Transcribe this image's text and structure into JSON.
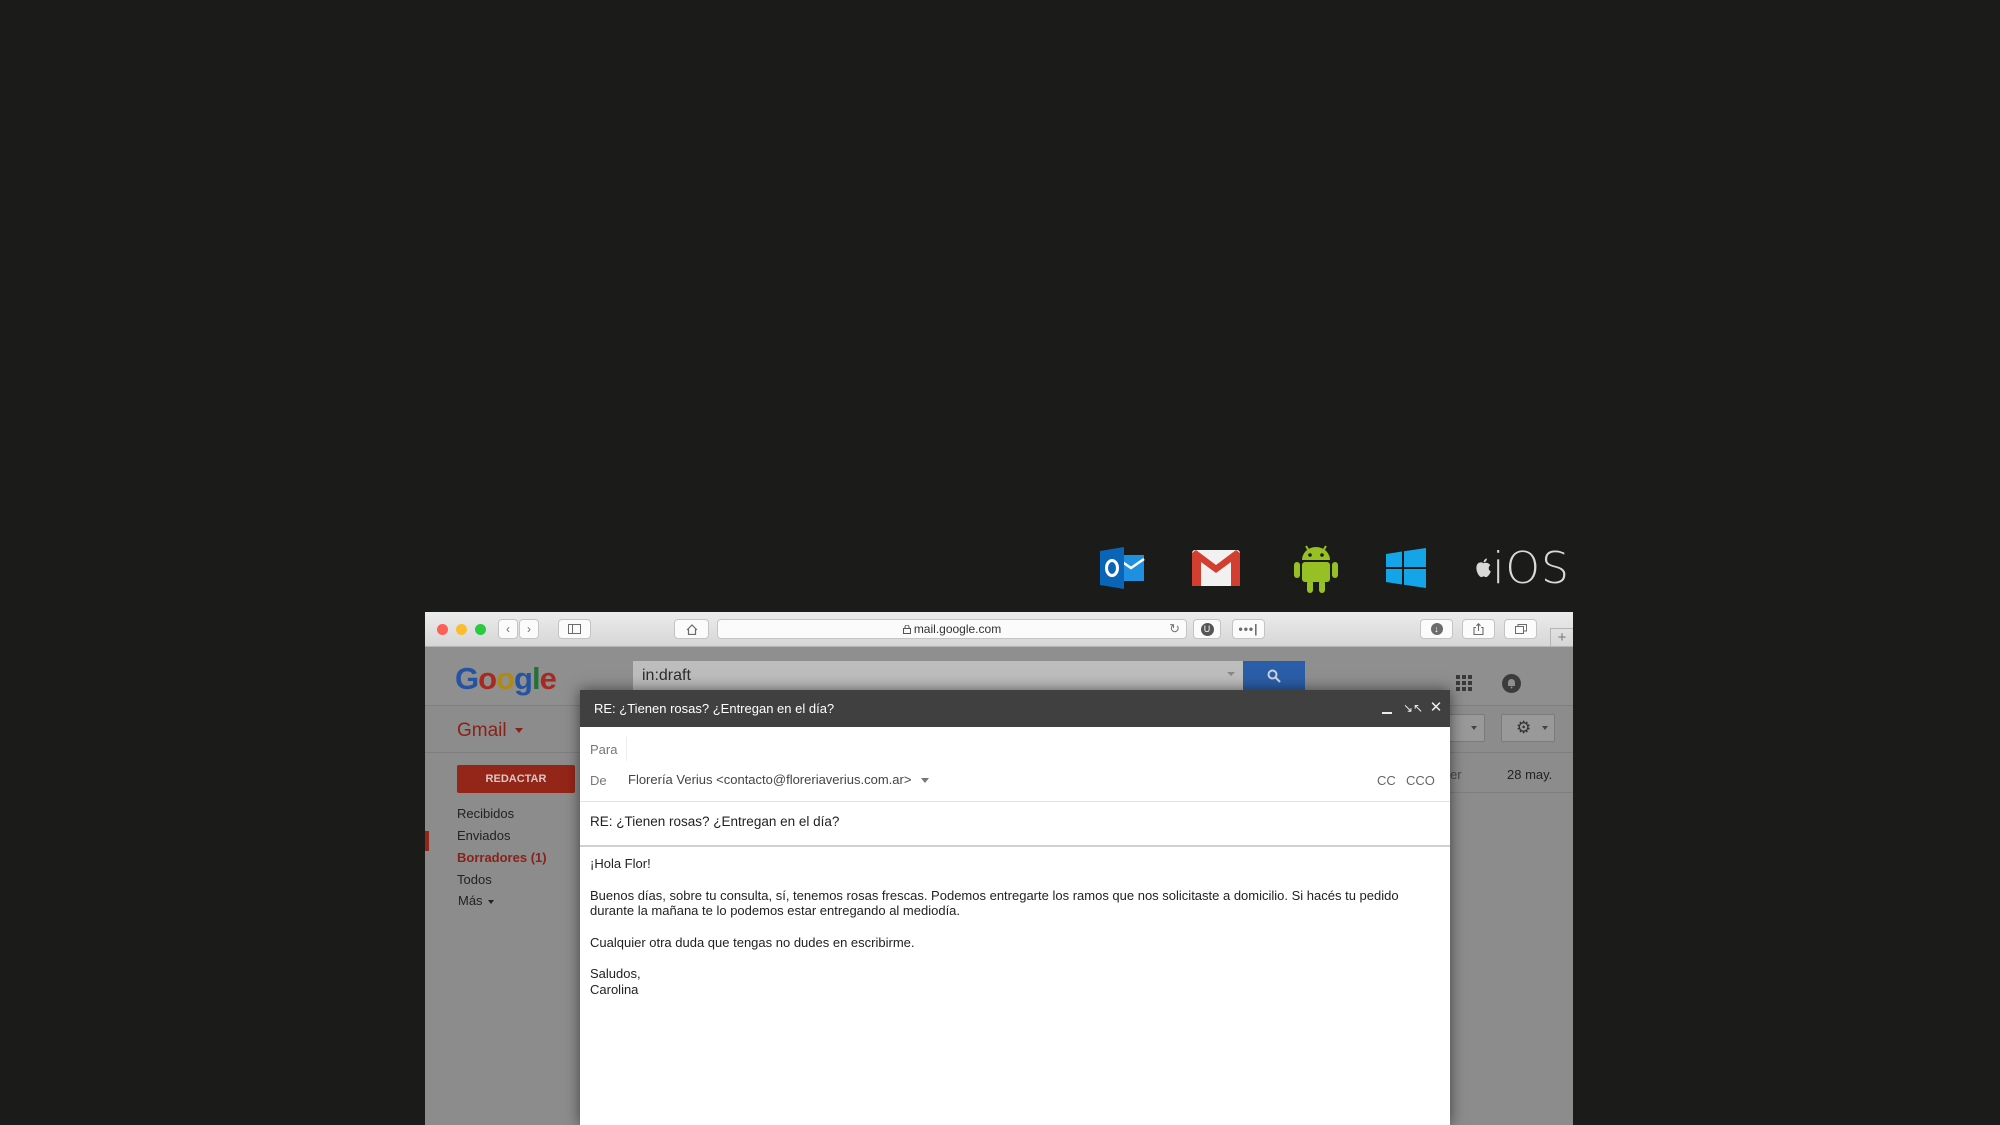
{
  "platform_icons": [
    {
      "name": "outlook-icon",
      "color": "#0a64b8"
    },
    {
      "name": "gmail-icon",
      "color": "#d23f31"
    },
    {
      "name": "android-icon",
      "color": "#97c024"
    },
    {
      "name": "windows-icon",
      "color": "#14a5e8"
    },
    {
      "name": "apple-icon",
      "color": "#d9d9d9",
      "label": "iOS"
    }
  ],
  "browser": {
    "url": "mail.google.com"
  },
  "gmail": {
    "logo_text": "Google",
    "search_query": "in:draft",
    "app_label": "Gmail",
    "compose_label": "REDACTAR",
    "nav": [
      {
        "label": "Recibidos"
      },
      {
        "label": "Enviados"
      },
      {
        "label": "Borradores (1)",
        "active": true
      },
      {
        "label": "Todos"
      },
      {
        "label": "Más"
      }
    ],
    "list_row": {
      "snippet": "er",
      "date": "28 may."
    }
  },
  "compose": {
    "title": "RE: ¿Tienen rosas? ¿Entregan en el día?",
    "to_label": "Para",
    "from_label": "De",
    "from_value": "Florería Verius <contacto@floreriaverius.com.ar>",
    "cc_label": "CC",
    "bcc_label": "CCO",
    "subject": "RE: ¿Tienen rosas? ¿Entregan en el día?",
    "body": {
      "greeting": "¡Hola Flor!",
      "paragraph1_line1": "Buenos días, sobre tu consulta, sí, tenemos rosas frescas. Podemos entregarte los ramos que nos solicitaste a domicilio. Si hacés tu pedido",
      "paragraph1_line2": "durante la mañana te lo podemos estar entregando al mediodía.",
      "paragraph2": "Cualquier otra duda que tengas no dudes en escribirme.",
      "closing": "Saludos,",
      "signature": "Carolina"
    }
  }
}
